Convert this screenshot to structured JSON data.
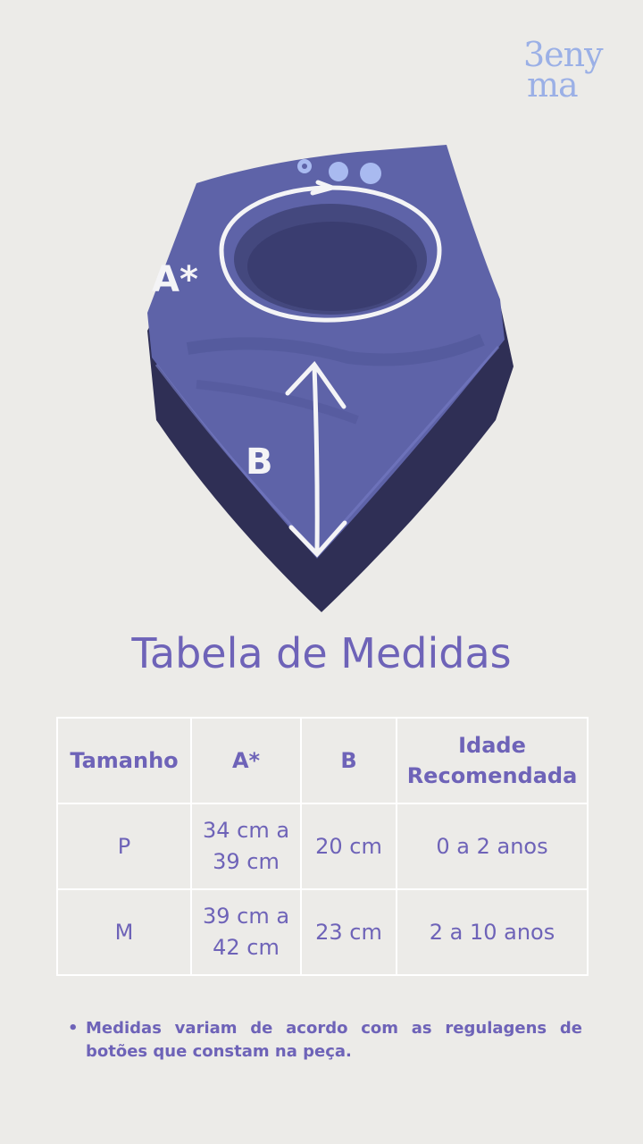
{
  "brand": {
    "logo_line1": "3eny",
    "logo_line2": "ma"
  },
  "illustration": {
    "label_a": "A*",
    "label_b": "B",
    "colors": {
      "bib_front": "#5e63a8",
      "bib_back": "#2f2f55",
      "arrows": "#f4f4f6",
      "snaps": "#a9baf0"
    }
  },
  "title": "Tabela de Medidas",
  "table": {
    "headers": [
      "Tamanho",
      "A*",
      "B",
      "Idade Recomendada"
    ],
    "rows": [
      [
        "P",
        "34 cm a 39 cm",
        "20 cm",
        "0 a 2 anos"
      ],
      [
        "M",
        "39 cm a 42 cm",
        "23 cm",
        "2 a 10 anos"
      ]
    ]
  },
  "note": "Medidas variam de acordo com as regulagens de botões que constam na peça.",
  "colors": {
    "accent": "#6e63b8",
    "background": "#ecebe8"
  }
}
